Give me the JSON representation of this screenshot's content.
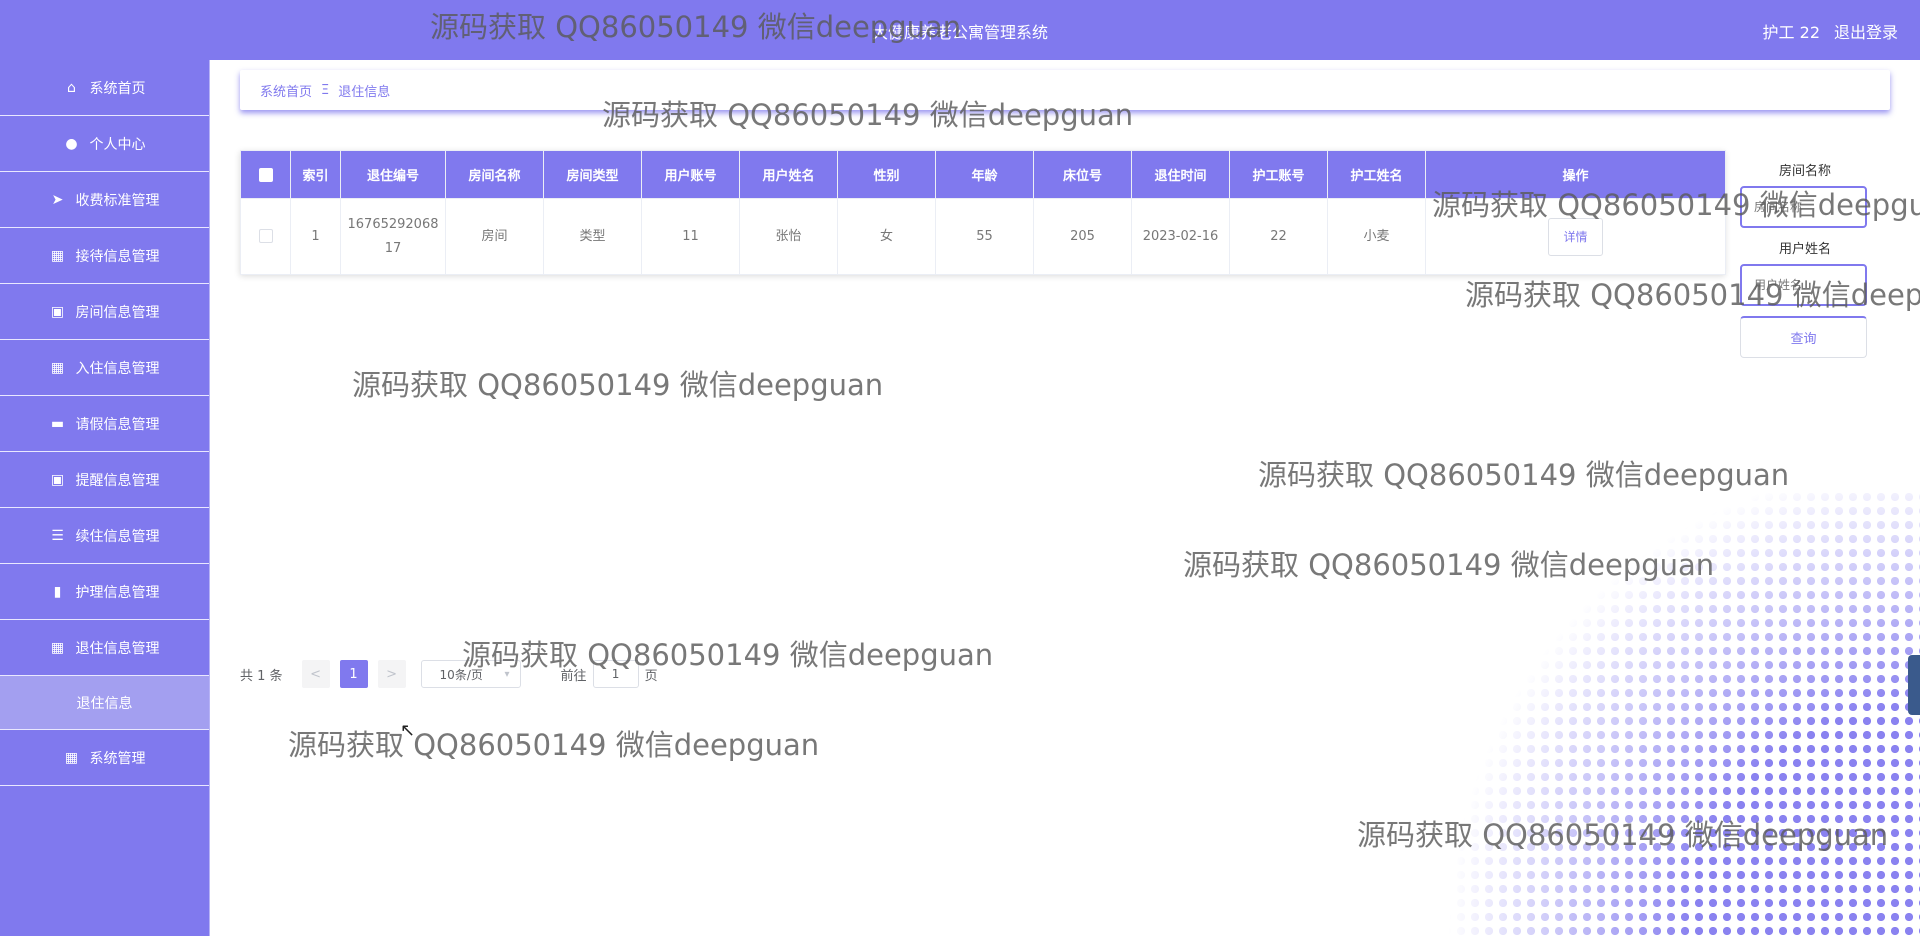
{
  "header": {
    "title": "大健康养老公寓管理系统",
    "user": "护工 22",
    "logout": "退出登录"
  },
  "sidebar": {
    "items": [
      {
        "label": "系统首页",
        "icon": "home-icon"
      },
      {
        "label": "个人中心",
        "icon": "user-icon"
      },
      {
        "label": "收费标准管理",
        "icon": "paper-plane-icon"
      },
      {
        "label": "接待信息管理",
        "icon": "grid-icon"
      },
      {
        "label": "房间信息管理",
        "icon": "clipboard-icon"
      },
      {
        "label": "入住信息管理",
        "icon": "grid-icon"
      },
      {
        "label": "请假信息管理",
        "icon": "briefcase-icon"
      },
      {
        "label": "提醒信息管理",
        "icon": "clipboard-icon"
      },
      {
        "label": "续住信息管理",
        "icon": "list-icon"
      },
      {
        "label": "护理信息管理",
        "icon": "chart-icon"
      },
      {
        "label": "退住信息管理",
        "icon": "grid-icon"
      }
    ],
    "active_sub": "退住信息",
    "last_item": {
      "label": "系统管理",
      "icon": "grid-icon"
    }
  },
  "breadcrumb": {
    "home": "系统首页",
    "separator": "Ξ",
    "current": "退住信息"
  },
  "table": {
    "headers": [
      "索引",
      "退住编号",
      "房间名称",
      "房间类型",
      "用户账号",
      "用户姓名",
      "性别",
      "年龄",
      "床位号",
      "退住时间",
      "护工账号",
      "护工姓名",
      "操作"
    ],
    "rows": [
      {
        "index": "1",
        "number": "1676529206817",
        "room_name": "房间",
        "room_type": "类型",
        "user_account": "11",
        "user_name": "张怡",
        "gender": "女",
        "age": "55",
        "bed": "205",
        "checkout_time": "2023-02-16",
        "nurse_account": "22",
        "nurse_name": "小麦",
        "action": "详情"
      }
    ]
  },
  "search": {
    "room_label": "房间名称",
    "room_placeholder": "房间名称",
    "user_label": "用户姓名",
    "user_placeholder": "用户姓名",
    "button": "查询"
  },
  "pagination": {
    "total": "共 1 条",
    "prev": "<",
    "page": "1",
    "next": ">",
    "page_size": "10条/页",
    "goto": "前往",
    "jump_value": "1",
    "page_suffix": "页"
  },
  "watermark": "源码获取 QQ86050149 微信deepguan",
  "colors": {
    "primary": "#8079ee",
    "sub_active": "#a39ff0"
  }
}
